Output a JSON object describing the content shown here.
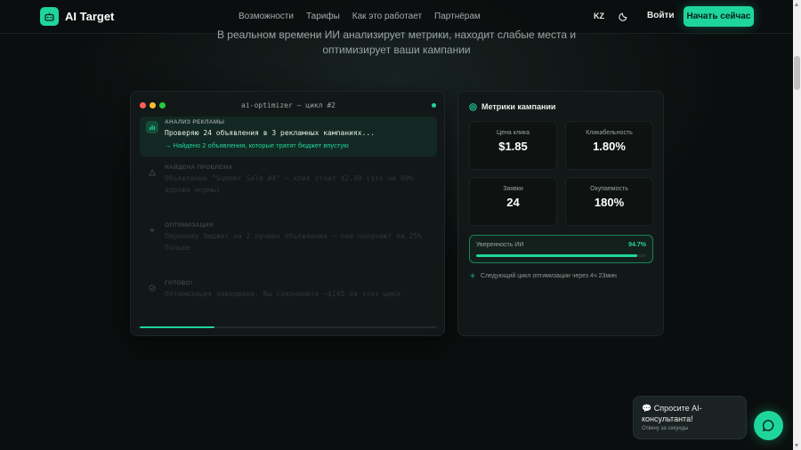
{
  "header": {
    "logo_text": "AI Target",
    "nav": [
      "Возможности",
      "Тарифы",
      "Как это работает",
      "Партнёрам"
    ],
    "lang": "KZ",
    "login": "Войти",
    "cta": "Начать сейчас"
  },
  "hero": {
    "subtitle": "В реальном времени ИИ анализирует метрики, находит слабые места и оптимизирует ваши кампании"
  },
  "terminal": {
    "title": "ai-optimizer — цикл #2",
    "progress_fraction": 0.25,
    "steps": [
      {
        "label": "АНАЛИЗ РЕКЛАМЫ",
        "text": "Проверяю 24 объявления в 3 рекламных кампаниях...",
        "result": "→ Найдено 2 объявления, которые тратят бюджет впустую"
      },
      {
        "label": "НАЙДЕНА ПРОБЛЕМА",
        "text": "Объявление \"Summer Sale #4\" — клик стоит $2.40 (это на 68% дороже нормы)"
      },
      {
        "label": "ОПТИМИЗАЦИЯ",
        "text": "Переношу бюджет на 2 лучших объявления — они получают на 25% больше"
      },
      {
        "label": "ГОТОВО!",
        "text": "Оптимизация завершена. Вы сэкономите ~$145 за этот цикл"
      }
    ]
  },
  "metrics": {
    "title": "Метрики кампании",
    "cards": [
      {
        "label": "Цена клика",
        "value": "$1.85"
      },
      {
        "label": "Кликабельность",
        "value": "1.80%"
      },
      {
        "label": "Заявки",
        "value": "24"
      },
      {
        "label": "Окупаемость",
        "value": "180%"
      }
    ],
    "confidence_label": "Уверенность ИИ",
    "confidence_value": "94.7%",
    "confidence_fraction": 0.947,
    "next_cycle": "Следующий цикл оптимизации через 4ч 23мин"
  },
  "chat": {
    "title": "💬 Спросите AI-консультанта!",
    "subtitle": "Отвечу за секунды"
  },
  "colors": {
    "accent": "#1fd69a",
    "background": "#0b0e0e",
    "panel": "#121817"
  }
}
